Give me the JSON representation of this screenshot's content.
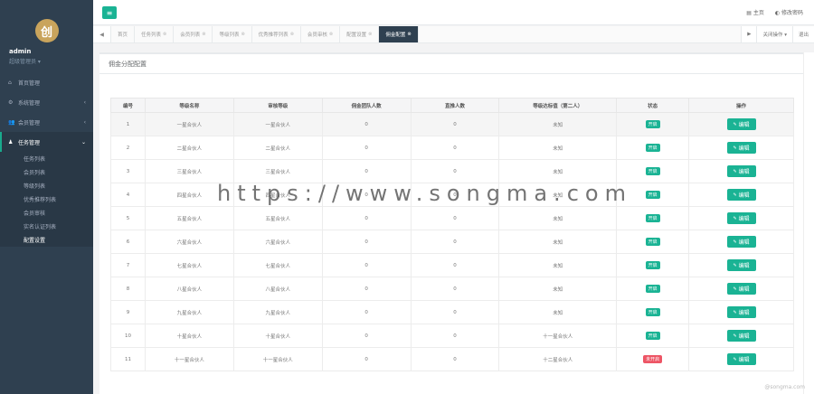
{
  "sidebar": {
    "avatar_char": "创",
    "username": "admin",
    "role": "超级管理员 ▾",
    "items": [
      {
        "label": "首页管理",
        "icon": "home-icon",
        "glyph": "⌂"
      },
      {
        "label": "系统管理",
        "icon": "gear-icon",
        "glyph": "⚙",
        "chev": "‹"
      },
      {
        "label": "会员管理",
        "icon": "users-icon",
        "glyph": "👥",
        "chev": "‹"
      }
    ],
    "open_item": {
      "label": "任务管理",
      "icon": "user-icon",
      "glyph": "♟",
      "chev": "⌄"
    },
    "sub_items": [
      "任务列表",
      "会员列表",
      "等级列表",
      "优秀推荐列表",
      "会员审核",
      "实名认证列表",
      "配置设置"
    ]
  },
  "topbar": {
    "menu_glyph": "≡",
    "right_items": [
      "▤ 主页",
      "◐ 修改密码"
    ]
  },
  "tabs": {
    "left_nav": "◀",
    "items": [
      "首页",
      "任务列表",
      "会员列表",
      "等级列表",
      "优秀推荐列表",
      "会员审核",
      "配置设置",
      "佣金配置"
    ],
    "active_index": 7,
    "right": [
      "▶",
      "关闭操作 ▾",
      "退出"
    ]
  },
  "panel": {
    "title": "佣金分配配置"
  },
  "table": {
    "headers": [
      "编号",
      "等级名称",
      "审核等级",
      "佣金团队人数",
      "直推人数",
      "等级达标值（第二人）",
      "状态",
      "操作"
    ],
    "rows": [
      [
        "1",
        "一星合伙人",
        "一星合伙人",
        "0",
        "0",
        "未知",
        "开启"
      ],
      [
        "2",
        "二星合伙人",
        "二星合伙人",
        "0",
        "0",
        "未知",
        "开启"
      ],
      [
        "3",
        "三星合伙人",
        "三星合伙人",
        "0",
        "0",
        "未知",
        "开启"
      ],
      [
        "4",
        "四星合伙人",
        "四星合伙人",
        "0",
        "0",
        "未知",
        "开启"
      ],
      [
        "5",
        "五星合伙人",
        "五星合伙人",
        "0",
        "0",
        "未知",
        "开启"
      ],
      [
        "6",
        "六星合伙人",
        "六星合伙人",
        "0",
        "0",
        "未知",
        "开启"
      ],
      [
        "7",
        "七星合伙人",
        "七星合伙人",
        "0",
        "0",
        "未知",
        "开启"
      ],
      [
        "8",
        "八星合伙人",
        "八星合伙人",
        "0",
        "0",
        "未知",
        "开启"
      ],
      [
        "9",
        "九星合伙人",
        "九星合伙人",
        "0",
        "0",
        "未知",
        "开启"
      ],
      [
        "10",
        "十星合伙人",
        "十星合伙人",
        "0",
        "0",
        "十一星合伙人",
        "开启"
      ],
      [
        "11",
        "十一星合伙人",
        "十一星合伙人",
        "0",
        "0",
        "十二星合伙人",
        "未开启"
      ]
    ],
    "edit_label": "编辑",
    "edit_glyph": "✎"
  },
  "watermark": "https://www.songma.com",
  "footer_mark": "@songma.com"
}
